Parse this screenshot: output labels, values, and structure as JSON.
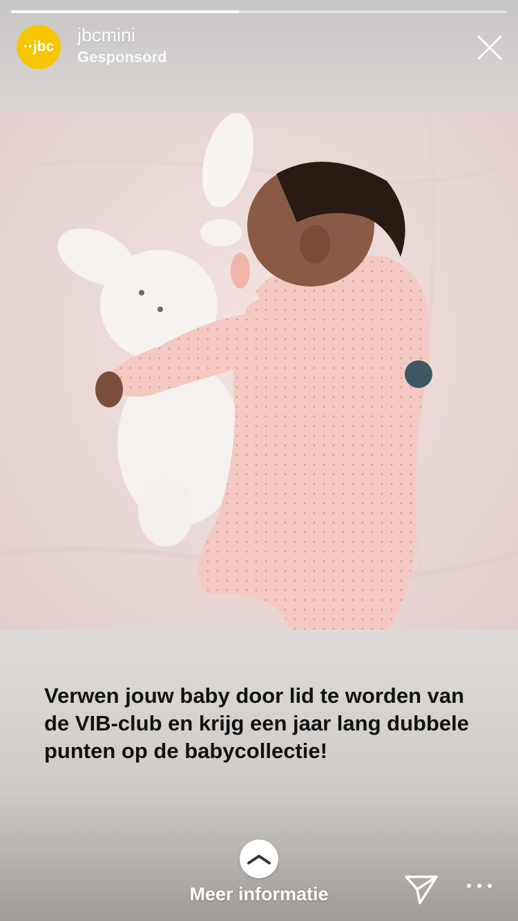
{
  "story": {
    "progress": 0.46
  },
  "header": {
    "avatar_text": "··jbc",
    "account_name": "jbcmini",
    "sponsored_label": "Gesponsord",
    "avatar_color": "#f7c600"
  },
  "photo": {
    "description_icon": "sleeping-baby-with-bunny-photo"
  },
  "caption": {
    "text": "Verwen jouw baby door lid te worden van de VIB-club en krijg een jaar lang dubbele punten op de babycollectie!"
  },
  "footer": {
    "swipe_icon": "chevron-up-icon",
    "more_info_label": "Meer informatie",
    "share_icon": "paper-plane-icon",
    "more_icon": "ellipsis-icon"
  }
}
